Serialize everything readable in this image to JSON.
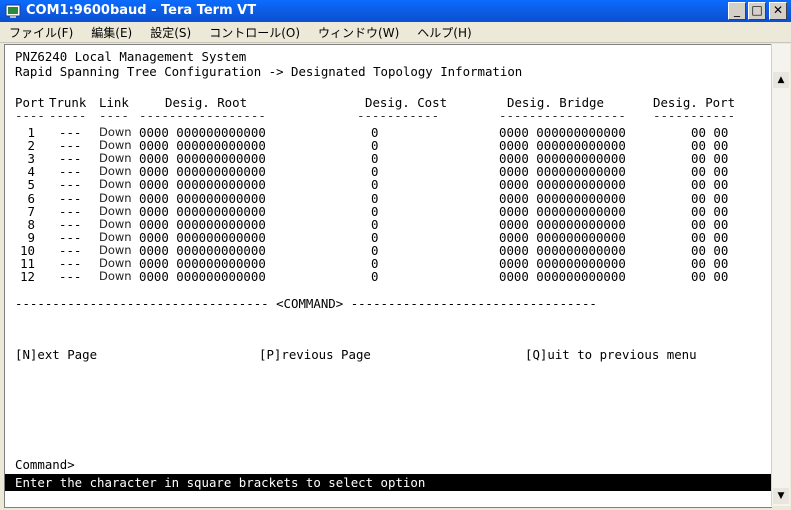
{
  "window": {
    "title": "COM1:9600baud - Tera Term VT"
  },
  "menu": [
    "ファイル(F)",
    "編集(E)",
    "設定(S)",
    "コントロール(O)",
    "ウィンドウ(W)",
    "ヘルプ(H)"
  ],
  "terminal": {
    "system_title": "PNZ6240 Local Management System",
    "breadcrumb": "Rapid Spanning Tree Configuration -> Designated Topology Information",
    "columns": [
      "Port",
      "Trunk",
      "Link",
      "Desig. Root",
      "Desig. Cost",
      "Desig. Bridge",
      "Desig. Port"
    ],
    "underlines": [
      "----",
      "-----",
      "----",
      "-----------------",
      "-----------",
      "-----------------",
      "-----------"
    ],
    "rows": [
      {
        "port": "1",
        "trunk": "---",
        "link": "Down",
        "root": "0000 000000000000",
        "cost": "0",
        "bridge": "0000 000000000000",
        "dport": "00 00"
      },
      {
        "port": "2",
        "trunk": "---",
        "link": "Down",
        "root": "0000 000000000000",
        "cost": "0",
        "bridge": "0000 000000000000",
        "dport": "00 00"
      },
      {
        "port": "3",
        "trunk": "---",
        "link": "Down",
        "root": "0000 000000000000",
        "cost": "0",
        "bridge": "0000 000000000000",
        "dport": "00 00"
      },
      {
        "port": "4",
        "trunk": "---",
        "link": "Down",
        "root": "0000 000000000000",
        "cost": "0",
        "bridge": "0000 000000000000",
        "dport": "00 00"
      },
      {
        "port": "5",
        "trunk": "---",
        "link": "Down",
        "root": "0000 000000000000",
        "cost": "0",
        "bridge": "0000 000000000000",
        "dport": "00 00"
      },
      {
        "port": "6",
        "trunk": "---",
        "link": "Down",
        "root": "0000 000000000000",
        "cost": "0",
        "bridge": "0000 000000000000",
        "dport": "00 00"
      },
      {
        "port": "7",
        "trunk": "---",
        "link": "Down",
        "root": "0000 000000000000",
        "cost": "0",
        "bridge": "0000 000000000000",
        "dport": "00 00"
      },
      {
        "port": "8",
        "trunk": "---",
        "link": "Down",
        "root": "0000 000000000000",
        "cost": "0",
        "bridge": "0000 000000000000",
        "dport": "00 00"
      },
      {
        "port": "9",
        "trunk": "---",
        "link": "Down",
        "root": "0000 000000000000",
        "cost": "0",
        "bridge": "0000 000000000000",
        "dport": "00 00"
      },
      {
        "port": "10",
        "trunk": "---",
        "link": "Down",
        "root": "0000 000000000000",
        "cost": "0",
        "bridge": "0000 000000000000",
        "dport": "00 00"
      },
      {
        "port": "11",
        "trunk": "---",
        "link": "Down",
        "root": "0000 000000000000",
        "cost": "0",
        "bridge": "0000 000000000000",
        "dport": "00 00"
      },
      {
        "port": "12",
        "trunk": "---",
        "link": "Down",
        "root": "0000 000000000000",
        "cost": "0",
        "bridge": "0000 000000000000",
        "dport": "00 00"
      }
    ],
    "command_separator": "---------------------------------- <COMMAND> ---------------------------------",
    "commands": {
      "next": "[N]ext Page",
      "previous": "[P]revious Page",
      "quit": "[Q]uit to previous menu"
    },
    "prompt": "Command>",
    "status": "Enter the character in square brackets to select option"
  },
  "colors": {
    "titlebar": "#0a5ce6",
    "status_bg": "#000000",
    "status_fg": "#ffffff"
  },
  "icons": [
    "teraterm-app-icon",
    "minimize-icon",
    "maximize-icon",
    "close-icon",
    "scroll-up-arrow-icon",
    "scroll-down-arrow-icon"
  ]
}
